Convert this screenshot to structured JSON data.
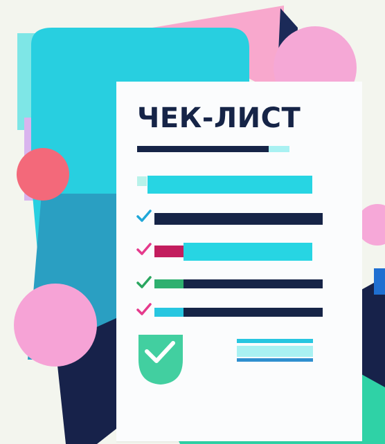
{
  "checklist": {
    "title": "ЧЕК-ЛИСТ"
  },
  "colors": {
    "navy": "#162447",
    "cyan": "#26d3e1",
    "teal": "#2fa6c0",
    "pink": "#f7a8d8",
    "coral": "#f36b7a",
    "green": "#33b87a",
    "mint": "#2fcf9c",
    "paper": "#fbfcfd",
    "background": "#f3f5ee"
  },
  "icons": [
    "checkmark-icon",
    "checkmark-icon",
    "checkmark-icon",
    "checkmark-icon",
    "check-badge-icon"
  ]
}
